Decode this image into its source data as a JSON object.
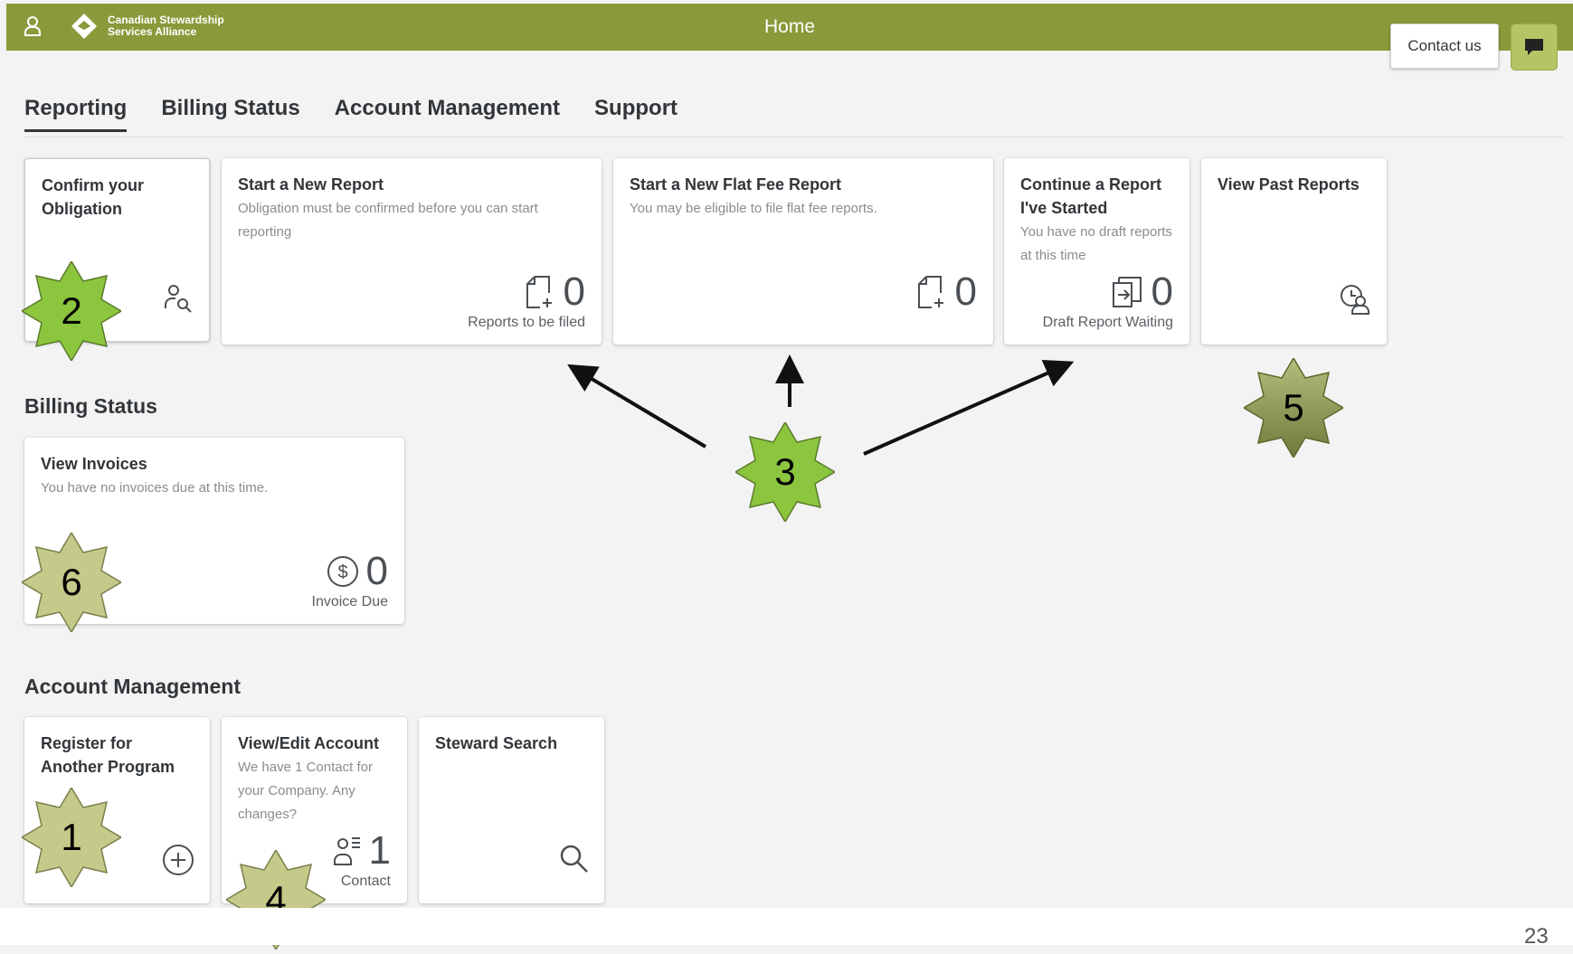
{
  "shell": {
    "brand": "Canadian Stewardship\nServices Alliance",
    "title": "Home",
    "contact_label": "Contact us",
    "icons": [
      "user-icon",
      "chat-icon"
    ],
    "color": "#8a9a3b"
  },
  "tabs": [
    {
      "label": "Reporting",
      "active": true
    },
    {
      "label": "Billing Status"
    },
    {
      "label": "Account Management"
    },
    {
      "label": "Support"
    }
  ],
  "reporting": {
    "confirm": {
      "title": "Confirm your Obligation",
      "icon": "user-search-icon"
    },
    "new_report": {
      "title": "Start a New Report",
      "subtitle": "Obligation must be confirmed before you can start reporting",
      "value": "0",
      "footer": "Reports to be filed",
      "icon": "add-document-icon"
    },
    "flat_fee": {
      "title": "Start a New Flat Fee Report",
      "subtitle": "You may be eligible to file flat fee reports.",
      "value": "0",
      "icon": "add-document-icon"
    },
    "continue": {
      "title": "Continue a Report I've Started",
      "subtitle": "You have no draft reports at this time",
      "value": "0",
      "footer": "Draft Report Waiting",
      "icon": "open-document-icon"
    },
    "past": {
      "title": "View Past Reports",
      "icon": "history-user-icon"
    }
  },
  "billing": {
    "section_title": "Billing Status",
    "invoices": {
      "title": "View Invoices",
      "subtitle": "You have no invoices due at this time.",
      "value": "0",
      "footer": "Invoice Due",
      "icon": "dollar-icon"
    }
  },
  "account": {
    "section_title": "Account Management",
    "register": {
      "title": "Register for Another Program",
      "icon": "add-circle-icon"
    },
    "view_edit": {
      "title": "View/Edit Account",
      "subtitle": "We have 1 Contact for your Company. Any changes?",
      "value": "1",
      "footer": "Contact",
      "icon": "contact-list-icon"
    },
    "steward_search": {
      "title": "Steward Search",
      "icon": "search-icon"
    }
  },
  "callouts": [
    "1",
    "2",
    "3",
    "4",
    "5",
    "6"
  ],
  "callout_colors": {
    "bright_green": "#8cc63f",
    "olive": "#9aa46a",
    "pale": "#c9cc8a"
  },
  "page_number": "23"
}
